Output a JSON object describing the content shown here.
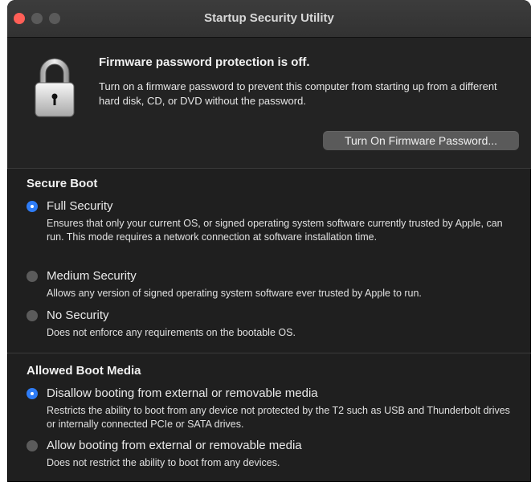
{
  "window": {
    "title": "Startup Security Utility"
  },
  "firmware": {
    "heading": "Firmware password protection is off.",
    "description": "Turn on a firmware password to prevent this computer from starting up from a different hard disk, CD, or DVD without the password.",
    "button_label": "Turn On Firmware Password..."
  },
  "secure_boot": {
    "title": "Secure Boot",
    "options": [
      {
        "label": "Full Security",
        "description": "Ensures that only your current OS, or signed operating system software currently trusted by Apple, can run. This mode requires a network connection at software installation time.",
        "selected": true
      },
      {
        "label": "Medium Security",
        "description": "Allows any version of signed operating system software ever trusted by Apple to run.",
        "selected": false
      },
      {
        "label": "No Security",
        "description": "Does not enforce any requirements on the bootable OS.",
        "selected": false
      }
    ]
  },
  "boot_media": {
    "title": "Allowed Boot Media",
    "options": [
      {
        "label": "Disallow booting from external or removable media",
        "description": "Restricts the ability to boot from any device not protected by the T2 such as USB and Thunderbolt drives or internally connected PCIe or SATA drives.",
        "selected": true
      },
      {
        "label": "Allow booting from external or removable media",
        "description": "Does not restrict the ability to boot from any devices.",
        "selected": false
      }
    ]
  },
  "colors": {
    "accent": "#2e7cf6",
    "window_background": "#1f1f1f",
    "close_button": "#ff5f57"
  },
  "icons": [
    "close-icon",
    "minimize-icon",
    "maximize-icon",
    "padlock-icon"
  ]
}
